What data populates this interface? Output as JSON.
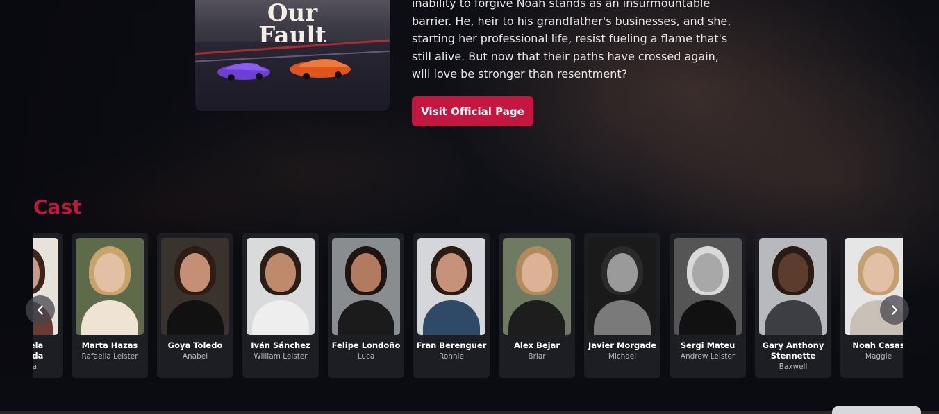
{
  "hero": {
    "poster_title_line1": "Our",
    "poster_title_line2": "Fault",
    "description": "inability to forgive Noah stands as an insurmountable barrier. He, heir to his grandfather's businesses, and she, starting her professional life, resist fueling a flame that's still alive. But now that their paths have crossed again, will love be stronger than resentment?",
    "visit_button_label": "Visit Official Page",
    "accent_color": "#c3173f"
  },
  "cast": {
    "title": "Cast",
    "members": [
      {
        "name": "Gabriela Andrada",
        "role": "Zabala",
        "skin": "#c99b86",
        "hair": "#3b2418",
        "bg": "#e8e2dc",
        "cloth": "#6b3b33"
      },
      {
        "name": "Marta Hazas",
        "role": "Rafaella Leister",
        "skin": "#e3c0a3",
        "hair": "#c9a46a",
        "bg": "#5e6b4a",
        "cloth": "#efe4d4"
      },
      {
        "name": "Goya Toledo",
        "role": "Anabel",
        "skin": "#c48f74",
        "hair": "#2e1d15",
        "bg": "#3a332d",
        "cloth": "#111111"
      },
      {
        "name": "Iván Sánchez",
        "role": "William Leister",
        "skin": "#bf8a6b",
        "hair": "#2b1e16",
        "bg": "#d9dadc",
        "cloth": "#eeeeee"
      },
      {
        "name": "Felipe Londoño",
        "role": "Luca",
        "skin": "#b27a5e",
        "hair": "#1e1410",
        "bg": "#8a8d90",
        "cloth": "#1b1b1b"
      },
      {
        "name": "Fran Berenguer",
        "role": "Ronnie",
        "skin": "#c6927a",
        "hair": "#2a1c15",
        "bg": "#d4d6d9",
        "cloth": "#2f4a66"
      },
      {
        "name": "Alex Bejar",
        "role": "Briar",
        "skin": "#dcb196",
        "hair": "#b38a5c",
        "bg": "#6f7a63",
        "cloth": "#1d1d1d"
      },
      {
        "name": "Javier Morgade",
        "role": "Michael",
        "skin": "#9a9a9a",
        "hair": "#2a2a2a",
        "bg": "#1a1a1a",
        "cloth": "#7a7a7a"
      },
      {
        "name": "Sergi Mateu",
        "role": "Andrew Leister",
        "skin": "#a8a8a8",
        "hair": "#d9d9d9",
        "bg": "#555555",
        "cloth": "#111111"
      },
      {
        "name": "Gary Anthony Stennette",
        "role": "Baxwell",
        "skin": "#5c3c2c",
        "hair": "#2a1c14",
        "bg": "#b7b9bc",
        "cloth": "#3c3e44"
      },
      {
        "name": "Noah Casas",
        "role": "Maggie",
        "skin": "#e2c0a6",
        "hair": "#c4a070",
        "bg": "#e6e6e6",
        "cloth": "#c9c1b8"
      }
    ]
  },
  "controls": {
    "prev_icon": "chevron-left-icon",
    "next_icon": "chevron-right-icon"
  }
}
